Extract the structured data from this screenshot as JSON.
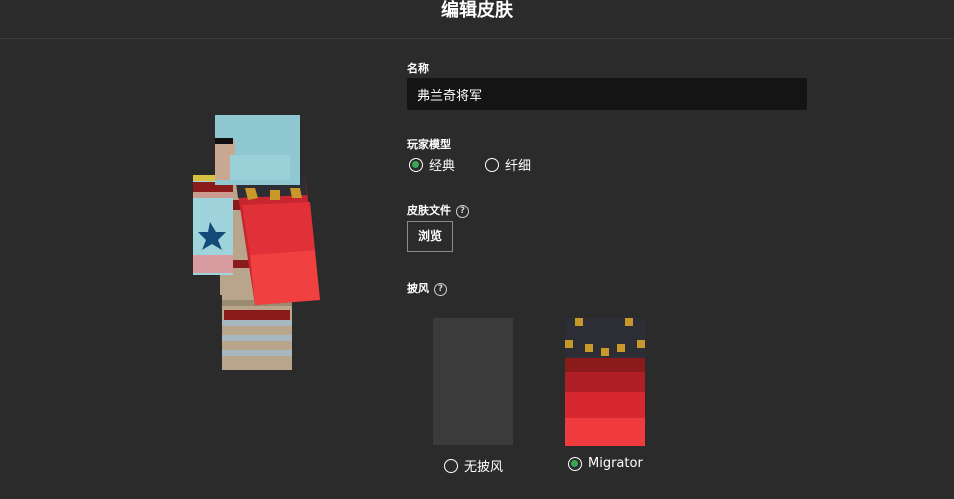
{
  "header": {
    "title": "编辑皮肤"
  },
  "form": {
    "name_label": "名称",
    "name_value": "弗兰奇将军",
    "model_label": "玩家模型",
    "model_options": [
      {
        "label": "经典",
        "selected": true
      },
      {
        "label": "纤细",
        "selected": false
      }
    ],
    "skin_file_label": "皮肤文件",
    "browse_label": "浏览",
    "cape_label": "披风",
    "cape_options": [
      {
        "label": "无披风",
        "selected": false
      },
      {
        "label": "Migrator",
        "selected": true
      }
    ],
    "help_glyph": "?"
  },
  "colors": {
    "accent": "#3aa757",
    "background": "#2b2b2b",
    "input_bg": "#141414"
  }
}
